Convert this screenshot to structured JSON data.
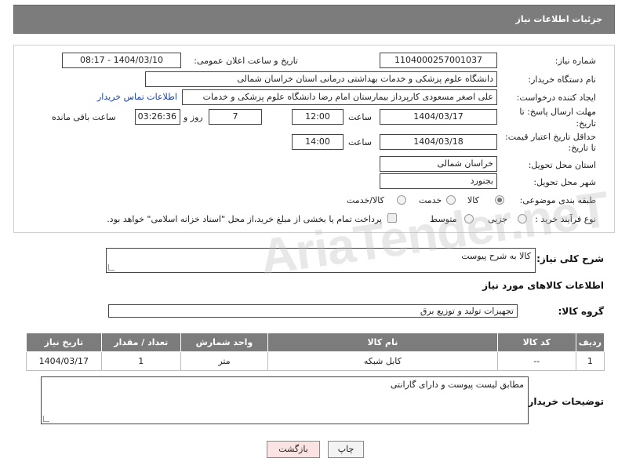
{
  "header": {
    "title": "جزئیات اطلاعات نیاز"
  },
  "form": {
    "need_number_label": "شماره نیاز:",
    "need_number": "1104000257001037",
    "announce_label": "تاریخ و ساعت اعلان عمومی:",
    "announce_value": "1404/03/10 - 08:17",
    "buyer_label": "نام دستگاه خریدار:",
    "buyer_value": "دانشگاه علوم پزشکی و خدمات بهداشتی درمانی استان خراسان شمالی",
    "creator_label": "ایجاد کننده درخواست:",
    "creator_value": "علی اصغر مسعودی کارپرداز بیمارستان امام رضا دانشگاه علوم پزشکی و خدمات",
    "contact_link": "اطلاعات تماس خریدار",
    "deadline_label_1": "مهلت ارسال پاسخ: تا",
    "deadline_label_2": "تاریخ:",
    "deadline_date": "1404/03/17",
    "time_label": "ساعت",
    "deadline_time": "12:00",
    "days_value": "7",
    "days_label": "روز و",
    "remaining_time": "03:26:36",
    "remaining_label": "ساعت باقی مانده",
    "validity_label_1": "حداقل تاریخ اعتبار قیمت:",
    "validity_label_2": "تا تاریخ:",
    "validity_date": "1404/03/18",
    "validity_time": "14:00",
    "province_label": "استان محل تحویل:",
    "province_value": "خراسان شمالی",
    "city_label": "شهر محل تحویل:",
    "city_value": "بجنورد",
    "category_label": "طبقه بندی موضوعی:",
    "category_options": [
      "کالا",
      "خدمت",
      "کالا/خدمت"
    ],
    "process_label": "نوع فرآیند خرید :",
    "process_options": [
      "جزیی",
      "متوسط"
    ],
    "payment_note": "پرداخت تمام یا بخشی از مبلغ خرید،از محل \"اسناد خزانه اسلامی\" خواهد بود."
  },
  "summary": {
    "label": "شرح کلی نیاز:",
    "value": "کالا به شرح پیوست"
  },
  "goods": {
    "section_title": "اطلاعات کالاهای مورد نیاز",
    "group_label": "گروه کالا:",
    "group_value": "تجهیزات تولید و توزیع برق",
    "columns": [
      "ردیف",
      "کد کالا",
      "نام کالا",
      "واحد شمارش",
      "تعداد / مقدار",
      "تاریخ نیاز"
    ],
    "rows": [
      [
        "1",
        "--",
        "کابل شبکه",
        "متر",
        "1",
        "1404/03/17"
      ]
    ]
  },
  "buyer_notes": {
    "label": "توضیحات خریدار:",
    "value": "مطابق لیست پیوست و دارای گارانتی"
  },
  "buttons": {
    "print": "چاپ",
    "back": "بازگشت"
  },
  "watermark": "AriaTender.neT",
  "colors": {
    "header_bg": "#7c7c7c",
    "link": "#1a3fa8",
    "back_button_bg": "#fbe3e3"
  }
}
